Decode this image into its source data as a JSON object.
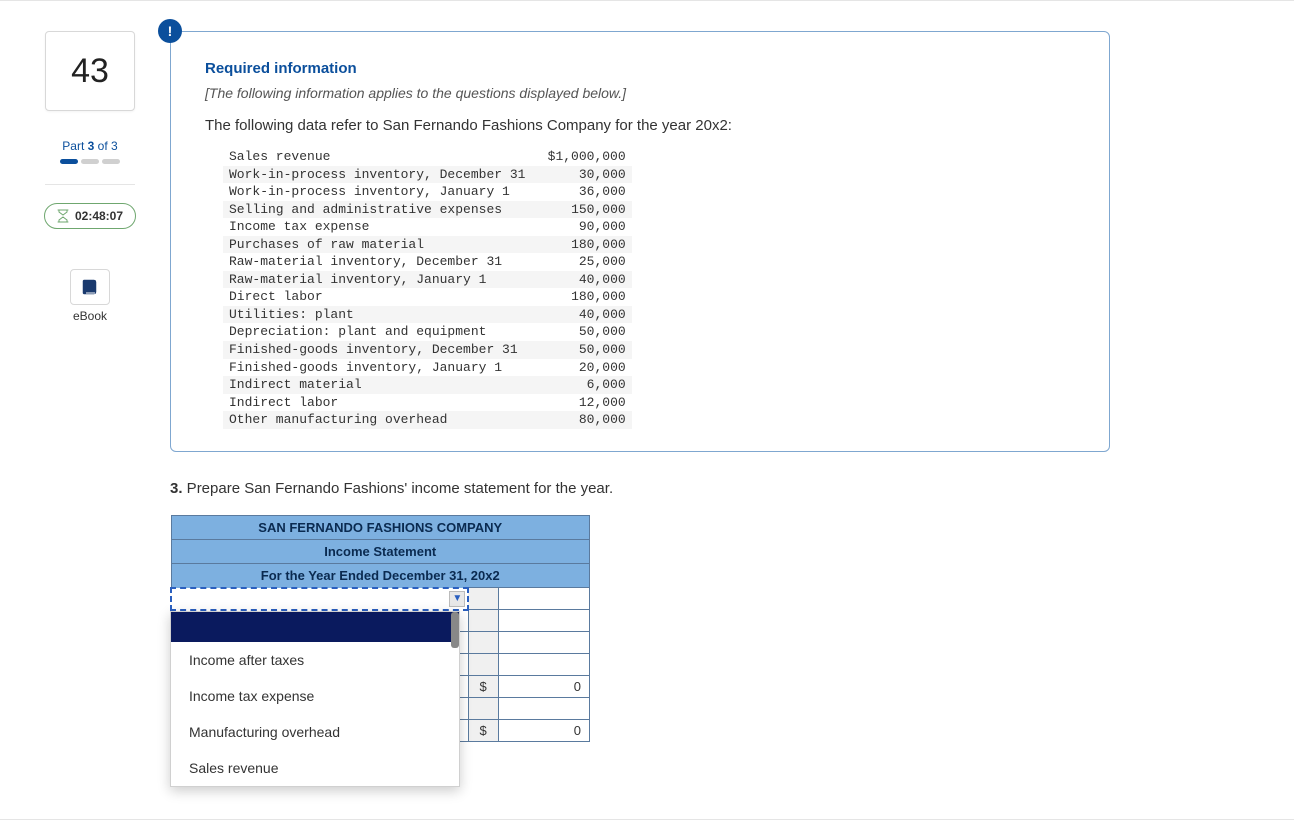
{
  "sidebar": {
    "question_number": "43",
    "part_prefix": "Part ",
    "part_current": "3",
    "part_of": " of 3",
    "timer": "02:48:07",
    "ebook_label": "eBook"
  },
  "info": {
    "badge": "!",
    "required_label": "Required information",
    "applies_text": "[The following information applies to the questions displayed below.]",
    "intro_text": "The following data refer to San Fernando Fashions Company for the year 20x2:"
  },
  "data_rows": [
    {
      "label": "Sales revenue",
      "currency": "$",
      "value": "1,000,000"
    },
    {
      "label": "Work-in-process inventory, December 31",
      "currency": "",
      "value": "30,000"
    },
    {
      "label": "Work-in-process inventory, January 1",
      "currency": "",
      "value": "36,000"
    },
    {
      "label": "Selling and administrative expenses",
      "currency": "",
      "value": "150,000"
    },
    {
      "label": "Income tax expense",
      "currency": "",
      "value": "90,000"
    },
    {
      "label": "Purchases of raw material",
      "currency": "",
      "value": "180,000"
    },
    {
      "label": "Raw-material inventory, December 31",
      "currency": "",
      "value": "25,000"
    },
    {
      "label": "Raw-material inventory, January 1",
      "currency": "",
      "value": "40,000"
    },
    {
      "label": "Direct labor",
      "currency": "",
      "value": "180,000"
    },
    {
      "label": "Utilities: plant",
      "currency": "",
      "value": "40,000"
    },
    {
      "label": "Depreciation: plant and equipment",
      "currency": "",
      "value": "50,000"
    },
    {
      "label": "Finished-goods inventory, December 31",
      "currency": "",
      "value": "50,000"
    },
    {
      "label": "Finished-goods inventory, January 1",
      "currency": "",
      "value": "20,000"
    },
    {
      "label": "Indirect material",
      "currency": "",
      "value": "6,000"
    },
    {
      "label": "Indirect labor",
      "currency": "",
      "value": "12,000"
    },
    {
      "label": "Other manufacturing overhead",
      "currency": "",
      "value": "80,000"
    }
  ],
  "question": {
    "number": "3.",
    "text": " Prepare San Fernando Fashions' income statement for the year."
  },
  "answer_table": {
    "h1": "SAN FERNANDO FASHIONS COMPANY",
    "h2": "Income Statement",
    "h3": "For the Year Ended December 31, 20x2",
    "zero": "0",
    "cur": "$"
  },
  "dropdown": {
    "opt_blank": "",
    "opt1": "Income after taxes",
    "opt2": "Income tax expense",
    "opt3": "Manufacturing overhead",
    "opt4": "Sales revenue"
  }
}
